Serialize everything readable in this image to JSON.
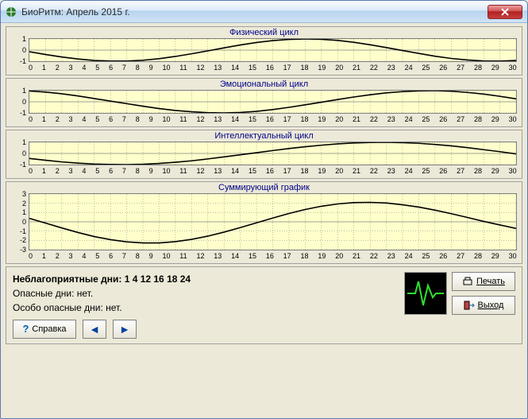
{
  "window": {
    "title": "БиоРитм: Апрель 2015 г."
  },
  "chart_data": [
    {
      "type": "line",
      "title": "Физический цикл",
      "x": [
        0,
        1,
        2,
        3,
        4,
        5,
        6,
        7,
        8,
        9,
        10,
        11,
        12,
        13,
        14,
        15,
        16,
        17,
        18,
        19,
        20,
        21,
        22,
        23,
        24,
        25,
        26,
        27,
        28,
        29,
        30
      ],
      "y": [
        -0.15,
        -0.4,
        -0.62,
        -0.8,
        -0.93,
        -0.99,
        -0.99,
        -0.91,
        -0.77,
        -0.57,
        -0.33,
        -0.07,
        0.2,
        0.46,
        0.68,
        0.85,
        0.96,
        1.0,
        0.97,
        0.87,
        0.7,
        0.48,
        0.23,
        -0.04,
        -0.3,
        -0.55,
        -0.75,
        -0.89,
        -0.98,
        -0.99,
        -0.93
      ],
      "ylim": [
        -1,
        1
      ],
      "xlim": [
        0,
        30
      ],
      "xlabel": "",
      "ylabel": ""
    },
    {
      "type": "line",
      "title": "Эмоциональный цикл",
      "x": [
        0,
        1,
        2,
        3,
        4,
        5,
        6,
        7,
        8,
        9,
        10,
        11,
        12,
        13,
        14,
        15,
        16,
        17,
        18,
        19,
        20,
        21,
        22,
        23,
        24,
        25,
        26,
        27,
        28,
        29,
        30
      ],
      "y": [
        0.97,
        0.87,
        0.72,
        0.52,
        0.29,
        0.06,
        -0.17,
        -0.4,
        -0.61,
        -0.78,
        -0.9,
        -0.98,
        -1.0,
        -0.96,
        -0.86,
        -0.7,
        -0.5,
        -0.27,
        -0.04,
        0.2,
        0.43,
        0.63,
        0.8,
        0.91,
        0.98,
        1.0,
        0.95,
        0.84,
        0.69,
        0.49,
        0.26
      ],
      "ylim": [
        -1,
        1
      ],
      "xlim": [
        0,
        30
      ],
      "xlabel": "",
      "ylabel": ""
    },
    {
      "type": "line",
      "title": "Интеллектуальный цикл",
      "x": [
        0,
        1,
        2,
        3,
        4,
        5,
        6,
        7,
        8,
        9,
        10,
        11,
        12,
        13,
        14,
        15,
        16,
        17,
        18,
        19,
        20,
        21,
        22,
        23,
        24,
        25,
        26,
        27,
        28,
        29,
        30
      ],
      "y": [
        -0.45,
        -0.61,
        -0.76,
        -0.87,
        -0.95,
        -0.99,
        -1.0,
        -0.97,
        -0.9,
        -0.79,
        -0.66,
        -0.49,
        -0.31,
        -0.12,
        0.07,
        0.26,
        0.44,
        0.6,
        0.74,
        0.86,
        0.94,
        0.99,
        1.0,
        0.97,
        0.91,
        0.81,
        0.68,
        0.52,
        0.34,
        0.16,
        -0.04
      ],
      "ylim": [
        -1,
        1
      ],
      "xlim": [
        0,
        30
      ],
      "xlabel": "",
      "ylabel": ""
    },
    {
      "type": "line",
      "title": "Суммирующий график",
      "x": [
        0,
        1,
        2,
        3,
        4,
        5,
        6,
        7,
        8,
        9,
        10,
        11,
        12,
        13,
        14,
        15,
        16,
        17,
        18,
        19,
        20,
        21,
        22,
        23,
        24,
        25,
        26,
        27,
        28,
        29,
        30
      ],
      "y": [
        0.37,
        -0.14,
        -0.66,
        -1.15,
        -1.59,
        -1.92,
        -2.16,
        -2.28,
        -2.28,
        -2.14,
        -1.89,
        -1.54,
        -1.11,
        -0.62,
        -0.11,
        0.41,
        0.9,
        1.33,
        1.68,
        1.93,
        2.07,
        2.1,
        2.03,
        1.84,
        1.59,
        1.26,
        0.88,
        0.47,
        0.05,
        -0.34,
        -0.71
      ],
      "ylim": [
        -3,
        3
      ],
      "xlim": [
        0,
        30
      ],
      "xlabel": "",
      "ylabel": ""
    }
  ],
  "summary": {
    "unfav_label": "Неблагоприятные дни:",
    "unfav_values": "1 4 12 16 18 24",
    "danger_label": "Опасные дни:",
    "danger_value": "нет.",
    "vdanger_label": "Особо опасные дни:",
    "vdanger_value": "нет."
  },
  "buttons": {
    "print": "Печать",
    "exit": "Выход",
    "help": "Справка"
  },
  "y_ticks_small": [
    "1",
    "0",
    "-1"
  ],
  "y_ticks_big": [
    "3",
    "2",
    "1",
    "0",
    "-1",
    "-2",
    "-3"
  ],
  "x_ticks": [
    "0",
    "1",
    "2",
    "3",
    "4",
    "5",
    "6",
    "7",
    "8",
    "9",
    "10",
    "11",
    "12",
    "13",
    "14",
    "15",
    "16",
    "17",
    "18",
    "19",
    "20",
    "21",
    "22",
    "23",
    "24",
    "25",
    "26",
    "27",
    "28",
    "29",
    "30"
  ]
}
